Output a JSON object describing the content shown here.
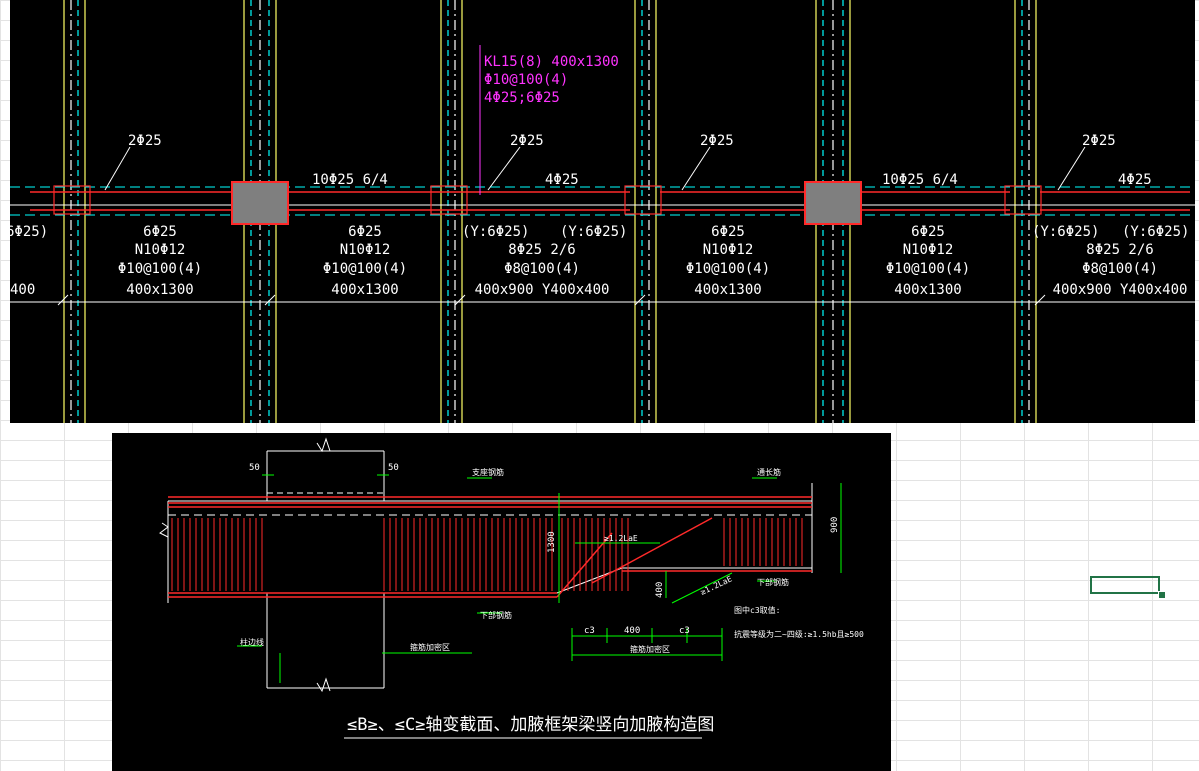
{
  "colors": {
    "background": "#000000",
    "beam_line": "#00ffff",
    "rebar": "#ff2a2a",
    "text": "#ffffff",
    "magenta_label": "#ff33ff",
    "column_fill": "#7f7f7f",
    "yellow_axis": "#ffff66",
    "green_dim": "#00ff00",
    "excel_select": "#217346"
  },
  "plan": {
    "callout": {
      "line1": "KL15(8) 400x1300",
      "line2": "Φ10@100(4)",
      "line3": "4Φ25;6Φ25"
    },
    "span_labels": [
      {
        "top": "2Φ25"
      },
      {
        "top": "10Φ25 6/4"
      },
      {
        "top": "2Φ25"
      },
      {
        "top": "4Φ25"
      },
      {
        "top": "2Φ25"
      },
      {
        "top": "10Φ25 6/4"
      },
      {
        "top": "2Φ25"
      },
      {
        "top": "4Φ25"
      }
    ],
    "edge_left": {
      "haunch": "6Φ25)",
      "size": "400"
    },
    "spans": [
      {
        "bottom": "6Φ25",
        "torsion": "N10Φ12",
        "stirrup": "Φ10@100(4)",
        "size": "400x1300"
      },
      {
        "bottom": "6Φ25",
        "torsion": "N10Φ12",
        "stirrup": "Φ10@100(4)",
        "size": "400x1300"
      },
      {
        "haunch_l": "(Y:6Φ25)",
        "haunch_r": "(Y:6Φ25)",
        "bottom": "8Φ25 2/6",
        "stirrup": "Φ8@100(4)",
        "size": "400x900 Y400x400"
      },
      {
        "bottom": "6Φ25",
        "torsion": "N10Φ12",
        "stirrup": "Φ10@100(4)",
        "size": "400x1300"
      },
      {
        "bottom": "6Φ25",
        "torsion": "N10Φ12",
        "stirrup": "Φ10@100(4)",
        "size": "400x1300"
      },
      {
        "haunch_l": "(Y:6Φ25)",
        "haunch_r": "(Y:6Φ25)",
        "bottom": "8Φ25 2/6",
        "stirrup": "Φ8@100(4)",
        "size": "400x900 Y400x400"
      }
    ]
  },
  "detail": {
    "title": "≤B≥、≤C≥轴变截面、加腋框架梁竖向加腋构造图",
    "dims": {
      "left_50": "50",
      "right_50": "50",
      "height_1300": "1300",
      "height_900": "900",
      "haunch_400": "400",
      "seg_c3_a": "c3",
      "seg_400": "400",
      "seg_c3_b": "c3"
    },
    "labels": {
      "top_bar": "支座钢筋",
      "top_right": "通长筋",
      "anchor_1": "≥1.2LaE",
      "anchor_2": "≥1.2LaE",
      "bottom_bar": "下部钢筋",
      "bottom_right": "下部钢筋",
      "column_label": "柱边线",
      "zone_left": "箍筋加密区",
      "zone_right": "箍筋加密区",
      "note_1": "图中c3取值:",
      "note_2": "抗震等级为二~四级:≥1.5hb且≥500"
    }
  }
}
